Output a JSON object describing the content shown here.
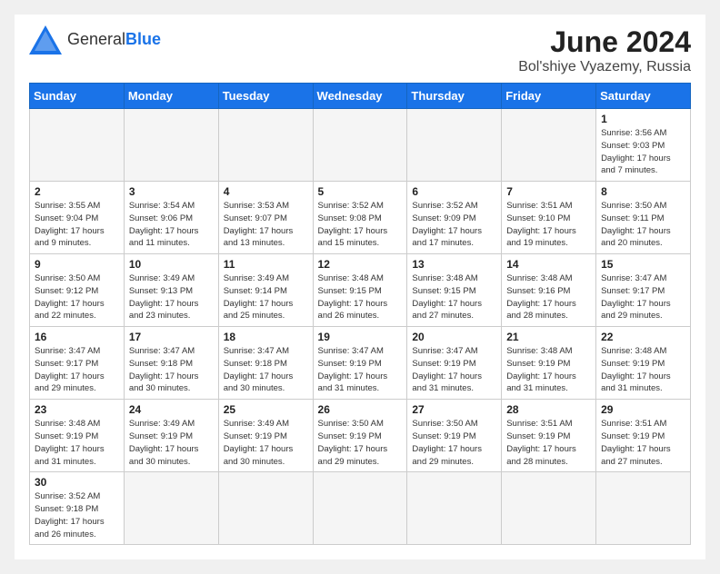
{
  "header": {
    "logo_word1": "General",
    "logo_word2": "Blue",
    "title": "June 2024",
    "subtitle": "Bol'shiye Vyazemy, Russia"
  },
  "weekdays": [
    "Sunday",
    "Monday",
    "Tuesday",
    "Wednesday",
    "Thursday",
    "Friday",
    "Saturday"
  ],
  "days": [
    {
      "num": "",
      "info": ""
    },
    {
      "num": "",
      "info": ""
    },
    {
      "num": "",
      "info": ""
    },
    {
      "num": "",
      "info": ""
    },
    {
      "num": "",
      "info": ""
    },
    {
      "num": "",
      "info": ""
    },
    {
      "num": "1",
      "info": "Sunrise: 3:56 AM\nSunset: 9:03 PM\nDaylight: 17 hours\nand 7 minutes."
    },
    {
      "num": "2",
      "info": "Sunrise: 3:55 AM\nSunset: 9:04 PM\nDaylight: 17 hours\nand 9 minutes."
    },
    {
      "num": "3",
      "info": "Sunrise: 3:54 AM\nSunset: 9:06 PM\nDaylight: 17 hours\nand 11 minutes."
    },
    {
      "num": "4",
      "info": "Sunrise: 3:53 AM\nSunset: 9:07 PM\nDaylight: 17 hours\nand 13 minutes."
    },
    {
      "num": "5",
      "info": "Sunrise: 3:52 AM\nSunset: 9:08 PM\nDaylight: 17 hours\nand 15 minutes."
    },
    {
      "num": "6",
      "info": "Sunrise: 3:52 AM\nSunset: 9:09 PM\nDaylight: 17 hours\nand 17 minutes."
    },
    {
      "num": "7",
      "info": "Sunrise: 3:51 AM\nSunset: 9:10 PM\nDaylight: 17 hours\nand 19 minutes."
    },
    {
      "num": "8",
      "info": "Sunrise: 3:50 AM\nSunset: 9:11 PM\nDaylight: 17 hours\nand 20 minutes."
    },
    {
      "num": "9",
      "info": "Sunrise: 3:50 AM\nSunset: 9:12 PM\nDaylight: 17 hours\nand 22 minutes."
    },
    {
      "num": "10",
      "info": "Sunrise: 3:49 AM\nSunset: 9:13 PM\nDaylight: 17 hours\nand 23 minutes."
    },
    {
      "num": "11",
      "info": "Sunrise: 3:49 AM\nSunset: 9:14 PM\nDaylight: 17 hours\nand 25 minutes."
    },
    {
      "num": "12",
      "info": "Sunrise: 3:48 AM\nSunset: 9:15 PM\nDaylight: 17 hours\nand 26 minutes."
    },
    {
      "num": "13",
      "info": "Sunrise: 3:48 AM\nSunset: 9:15 PM\nDaylight: 17 hours\nand 27 minutes."
    },
    {
      "num": "14",
      "info": "Sunrise: 3:48 AM\nSunset: 9:16 PM\nDaylight: 17 hours\nand 28 minutes."
    },
    {
      "num": "15",
      "info": "Sunrise: 3:47 AM\nSunset: 9:17 PM\nDaylight: 17 hours\nand 29 minutes."
    },
    {
      "num": "16",
      "info": "Sunrise: 3:47 AM\nSunset: 9:17 PM\nDaylight: 17 hours\nand 29 minutes."
    },
    {
      "num": "17",
      "info": "Sunrise: 3:47 AM\nSunset: 9:18 PM\nDaylight: 17 hours\nand 30 minutes."
    },
    {
      "num": "18",
      "info": "Sunrise: 3:47 AM\nSunset: 9:18 PM\nDaylight: 17 hours\nand 30 minutes."
    },
    {
      "num": "19",
      "info": "Sunrise: 3:47 AM\nSunset: 9:19 PM\nDaylight: 17 hours\nand 31 minutes."
    },
    {
      "num": "20",
      "info": "Sunrise: 3:47 AM\nSunset: 9:19 PM\nDaylight: 17 hours\nand 31 minutes."
    },
    {
      "num": "21",
      "info": "Sunrise: 3:48 AM\nSunset: 9:19 PM\nDaylight: 17 hours\nand 31 minutes."
    },
    {
      "num": "22",
      "info": "Sunrise: 3:48 AM\nSunset: 9:19 PM\nDaylight: 17 hours\nand 31 minutes."
    },
    {
      "num": "23",
      "info": "Sunrise: 3:48 AM\nSunset: 9:19 PM\nDaylight: 17 hours\nand 31 minutes."
    },
    {
      "num": "24",
      "info": "Sunrise: 3:49 AM\nSunset: 9:19 PM\nDaylight: 17 hours\nand 30 minutes."
    },
    {
      "num": "25",
      "info": "Sunrise: 3:49 AM\nSunset: 9:19 PM\nDaylight: 17 hours\nand 30 minutes."
    },
    {
      "num": "26",
      "info": "Sunrise: 3:50 AM\nSunset: 9:19 PM\nDaylight: 17 hours\nand 29 minutes."
    },
    {
      "num": "27",
      "info": "Sunrise: 3:50 AM\nSunset: 9:19 PM\nDaylight: 17 hours\nand 29 minutes."
    },
    {
      "num": "28",
      "info": "Sunrise: 3:51 AM\nSunset: 9:19 PM\nDaylight: 17 hours\nand 28 minutes."
    },
    {
      "num": "29",
      "info": "Sunrise: 3:51 AM\nSunset: 9:19 PM\nDaylight: 17 hours\nand 27 minutes."
    },
    {
      "num": "30",
      "info": "Sunrise: 3:52 AM\nSunset: 9:18 PM\nDaylight: 17 hours\nand 26 minutes."
    },
    {
      "num": "",
      "info": ""
    },
    {
      "num": "",
      "info": ""
    },
    {
      "num": "",
      "info": ""
    },
    {
      "num": "",
      "info": ""
    },
    {
      "num": "",
      "info": ""
    },
    {
      "num": "",
      "info": ""
    }
  ]
}
